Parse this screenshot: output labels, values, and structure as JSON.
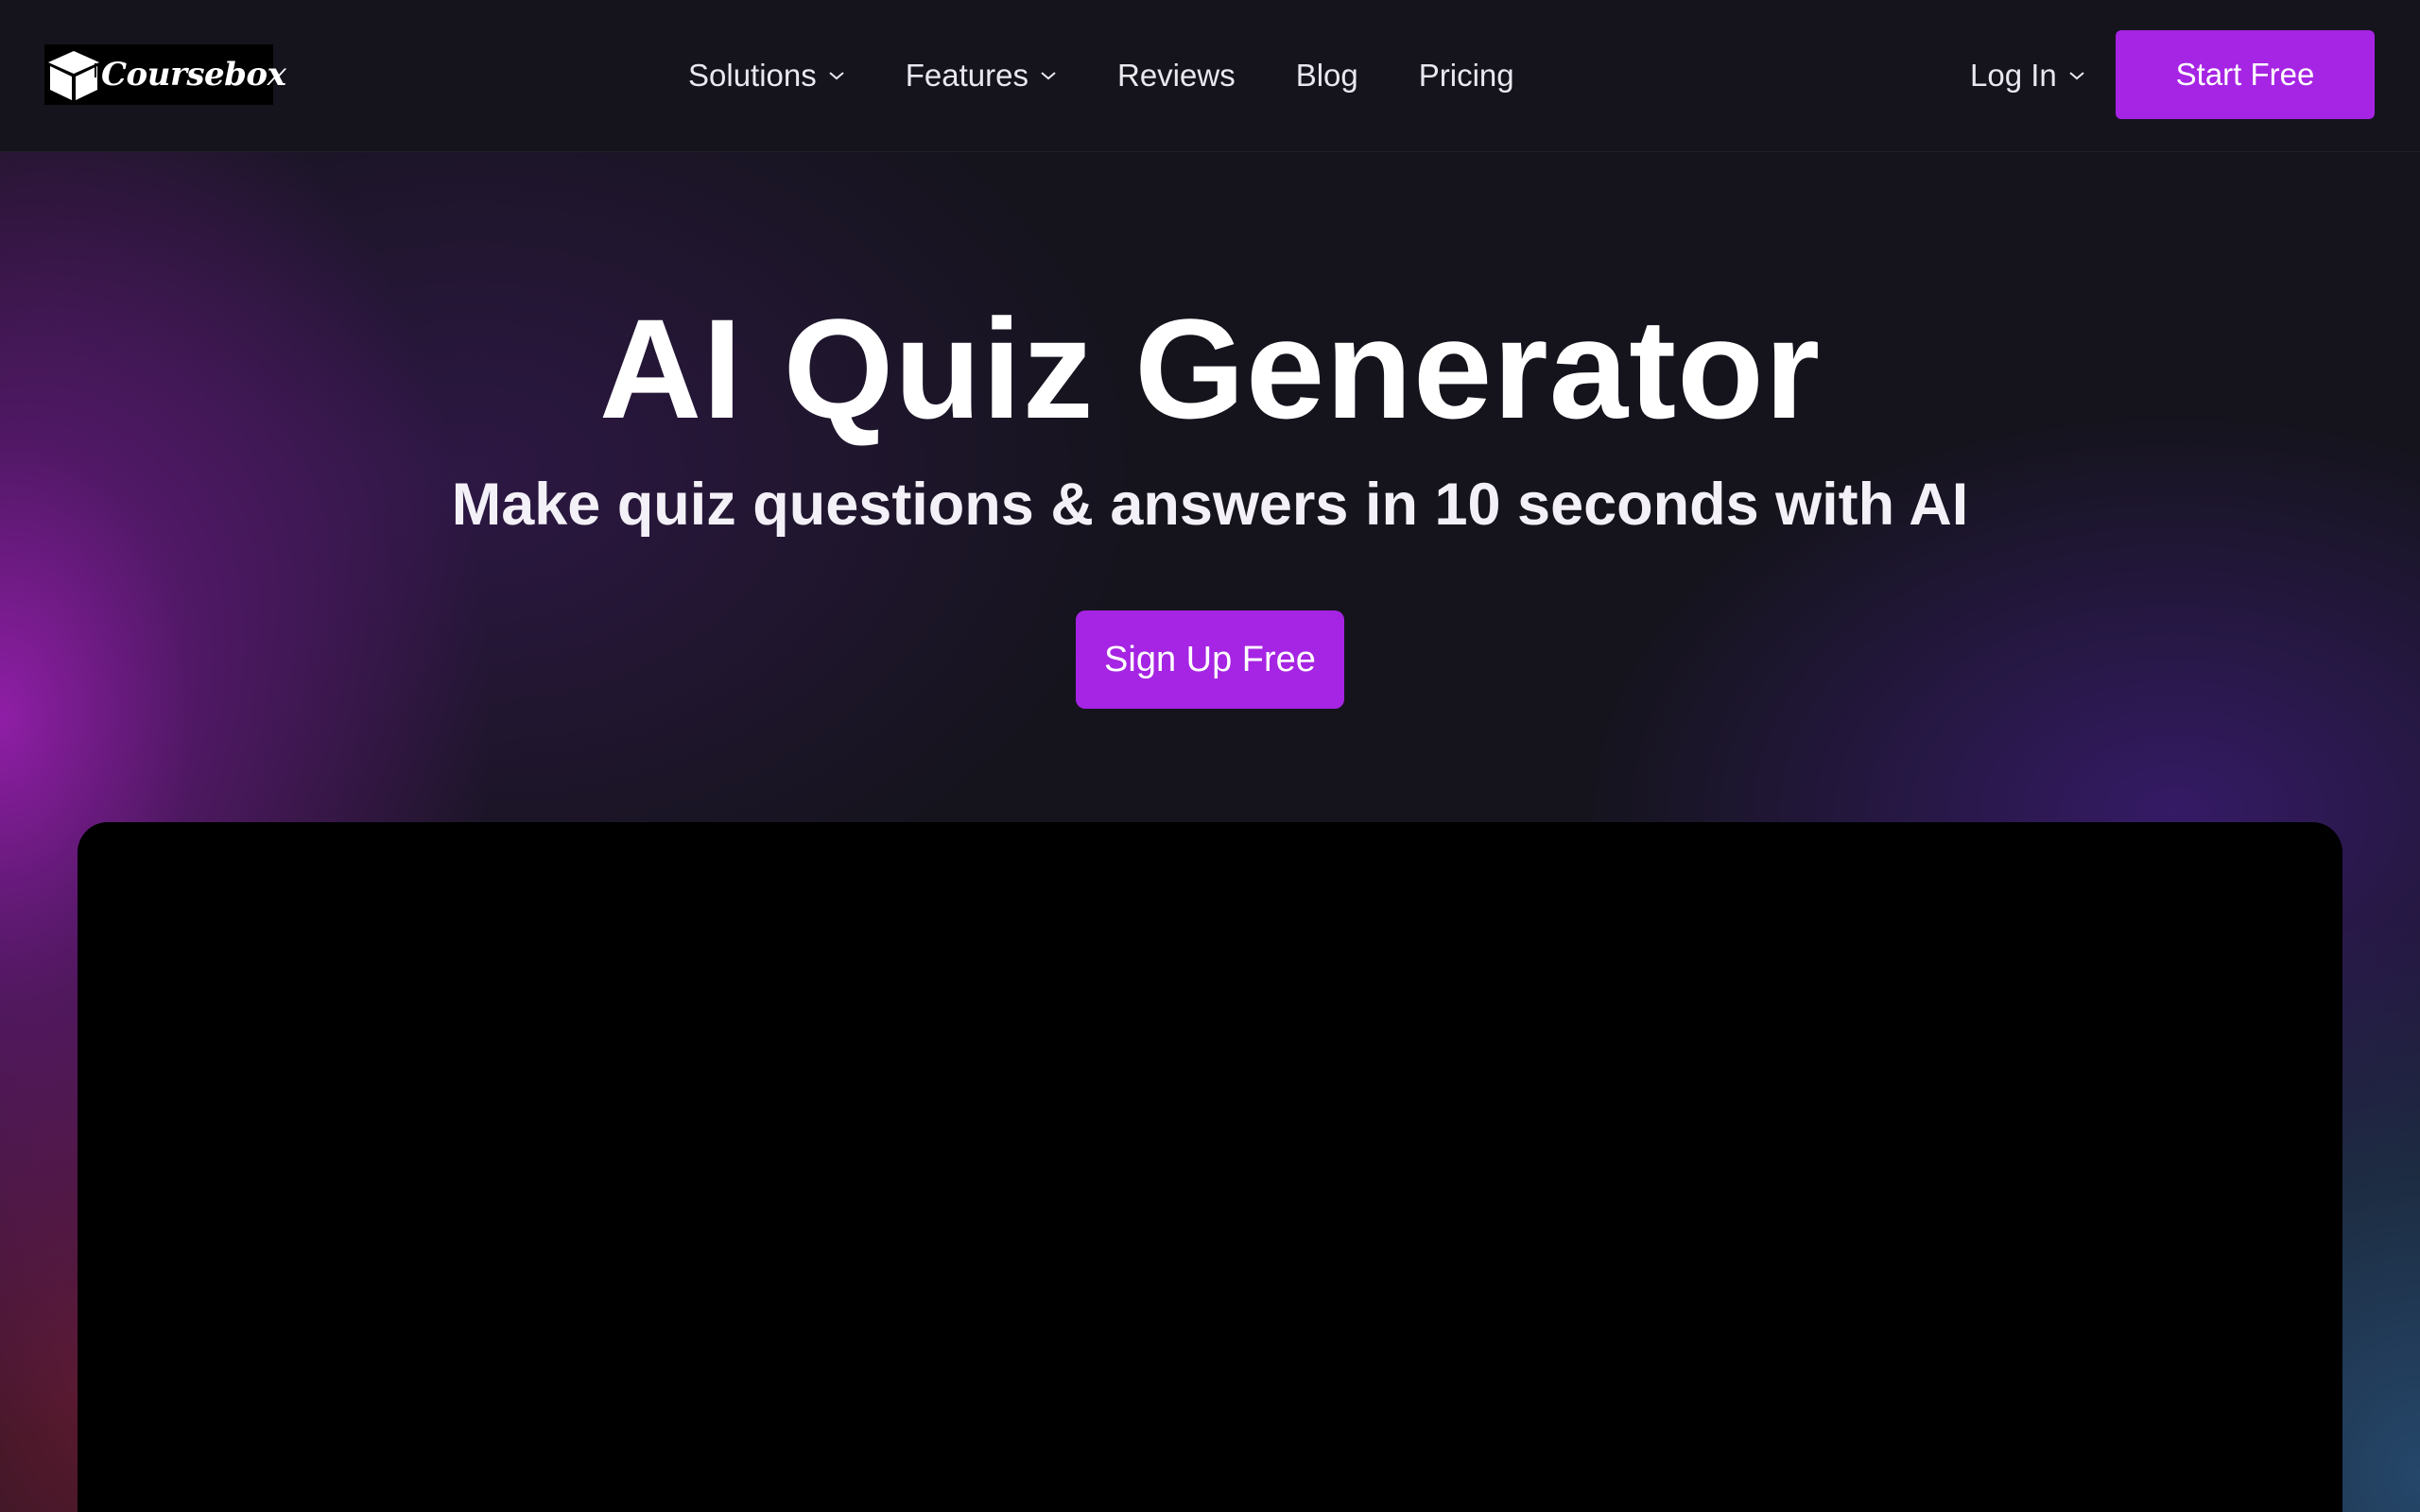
{
  "brand": {
    "name": "Coursebox",
    "accent_color": "#a624e3",
    "background_color": "#15141d"
  },
  "nav": {
    "items": [
      {
        "label": "Solutions",
        "has_dropdown": true
      },
      {
        "label": "Features",
        "has_dropdown": true
      },
      {
        "label": "Reviews",
        "has_dropdown": false
      },
      {
        "label": "Blog",
        "has_dropdown": false
      },
      {
        "label": "Pricing",
        "has_dropdown": false
      }
    ],
    "login_label": "Log In",
    "start_free_label": "Start Free"
  },
  "hero": {
    "title": "AI Quiz Generator",
    "subtitle": "Make quiz questions & answers in 10 seconds with AI",
    "cta_label": "Sign Up Free"
  },
  "icons": {
    "logo_mark": "graduation-cap-box-icon",
    "dropdown": "chevron-down-icon"
  }
}
